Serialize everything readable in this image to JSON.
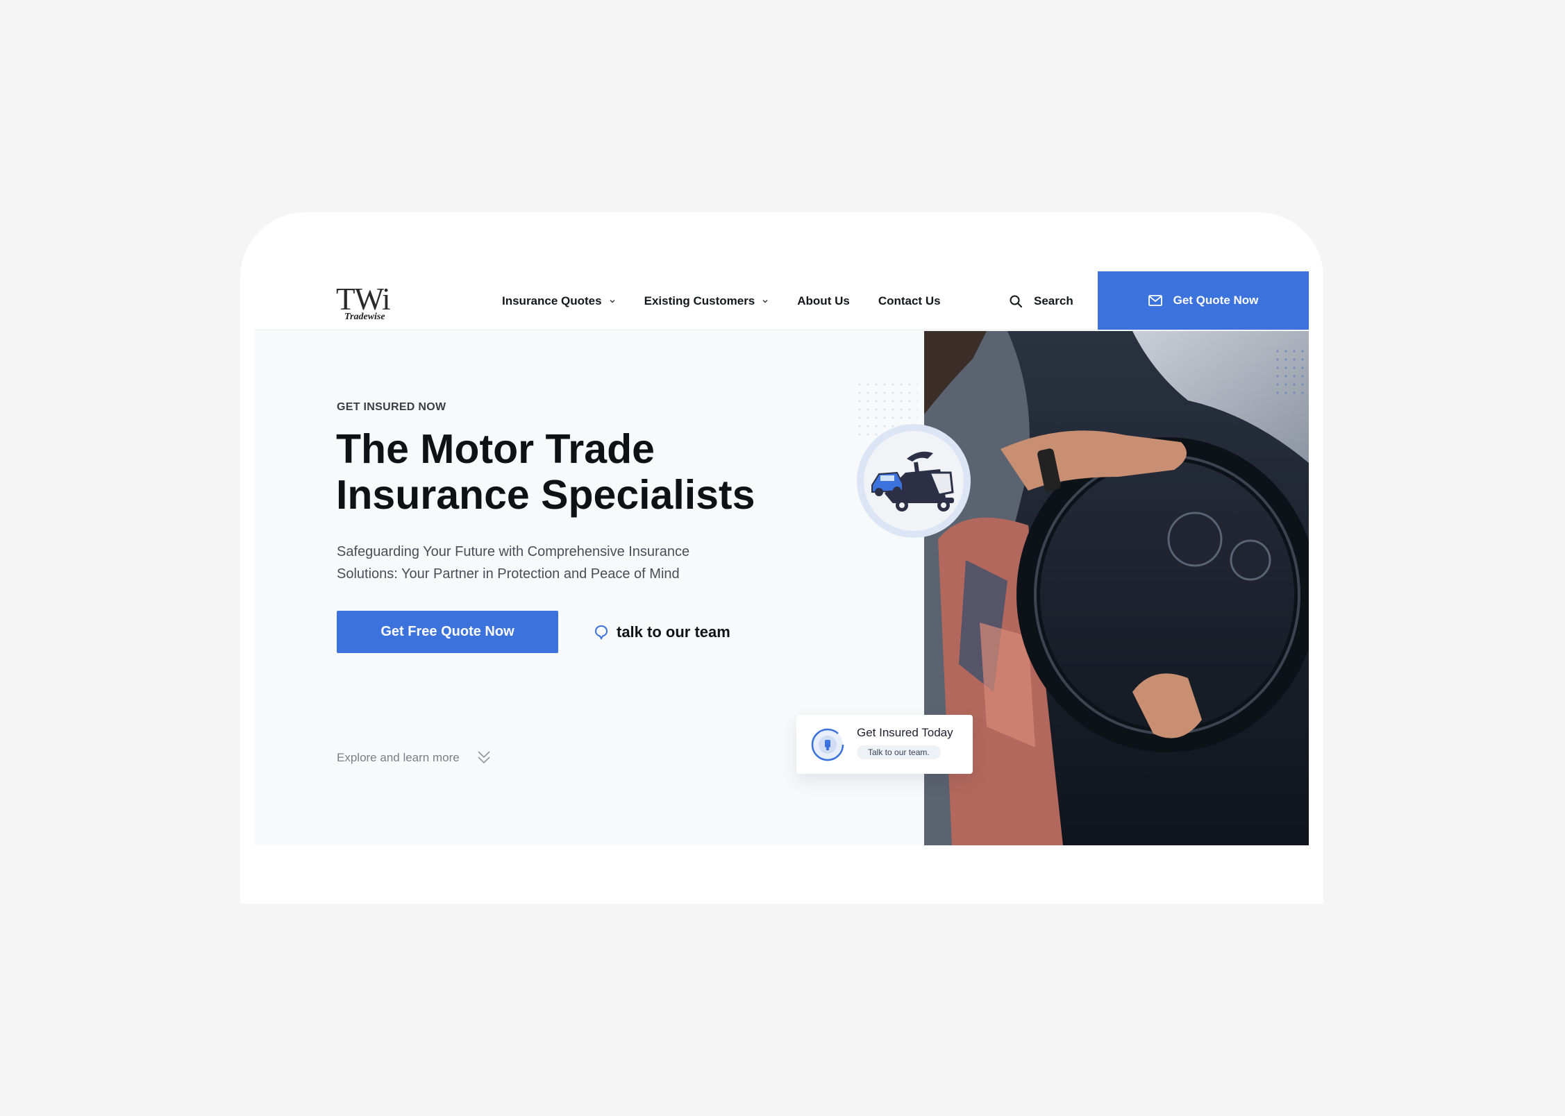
{
  "brand": {
    "logo_mark": "TWi",
    "logo_text": "Tradewise"
  },
  "nav": {
    "items": [
      {
        "label": "Insurance Quotes",
        "has_dropdown": true
      },
      {
        "label": "Existing Customers",
        "has_dropdown": true
      },
      {
        "label": "About Us",
        "has_dropdown": false
      },
      {
        "label": "Contact Us",
        "has_dropdown": false
      }
    ],
    "search_label": "Search",
    "quote_button_label": "Get Quote Now"
  },
  "hero": {
    "eyebrow": "GET INSURED NOW",
    "headline_line1": "The Motor Trade",
    "headline_line2": "Insurance Specialists",
    "subtext": "Safeguarding Your Future with Comprehensive Insurance Solutions: Your Partner in Protection and Peace of Mind",
    "cta_label": "Get Free Quote Now",
    "talk_label": "talk to our team",
    "explore_label": "Explore and learn more"
  },
  "info_card": {
    "title": "Get Insured Today",
    "pill_label": "Talk to our team."
  },
  "colors": {
    "accent": "#3c72dc",
    "page_bg": "#f5f5f6",
    "hero_bg": "#f8f9fb",
    "text_dark": "#0f1115"
  },
  "icons": [
    "chevron-down-icon",
    "search-icon",
    "mail-icon",
    "chat-bubble-icon",
    "double-chevron-down-icon",
    "tow-truck-icon",
    "shield-ring-icon"
  ]
}
